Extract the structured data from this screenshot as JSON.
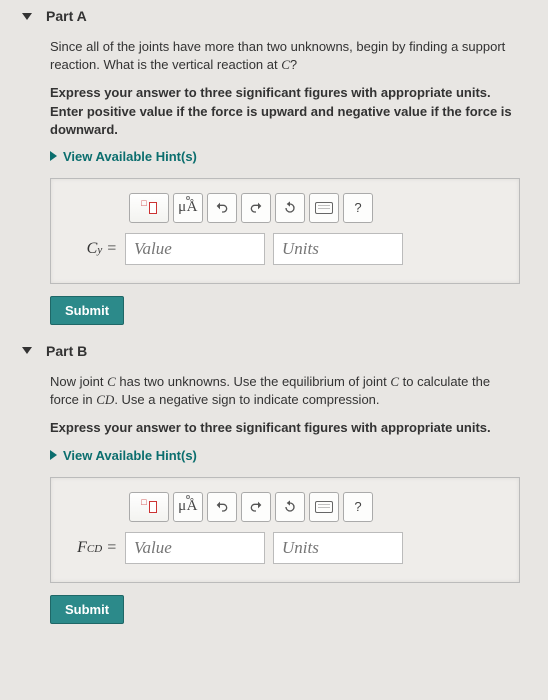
{
  "partA": {
    "title": "Part A",
    "prompt1_pre": "Since all of the joints have more than two unknowns, begin by finding a support reaction. What is the vertical reaction at ",
    "prompt1_var": "C",
    "prompt1_post": "?",
    "prompt2": "Express your answer to three significant figures with appropriate units. Enter positive value if the force is upward and negative value if the force is downward.",
    "hints": "View Available Hint(s)",
    "toolbar": {
      "mua": "μÅ",
      "help": "?"
    },
    "var_html": "C<span class='sub'>y</span> =",
    "value_ph": "Value",
    "units_ph": "Units",
    "submit": "Submit"
  },
  "partB": {
    "title": "Part B",
    "prompt1_a": "Now joint ",
    "prompt1_b": " has two unknowns. Use the equilibrium of joint ",
    "prompt1_c": " to calculate the force in ",
    "prompt1_d": ". Use a negative sign to indicate compression.",
    "var1": "C",
    "var2": "C",
    "var3": "CD",
    "prompt2": "Express your answer to three significant figures with appropriate units.",
    "hints": "View Available Hint(s)",
    "toolbar": {
      "mua": "μÅ",
      "help": "?"
    },
    "var_html": "F<span class='sub'>CD</span> =",
    "value_ph": "Value",
    "units_ph": "Units",
    "submit": "Submit"
  }
}
